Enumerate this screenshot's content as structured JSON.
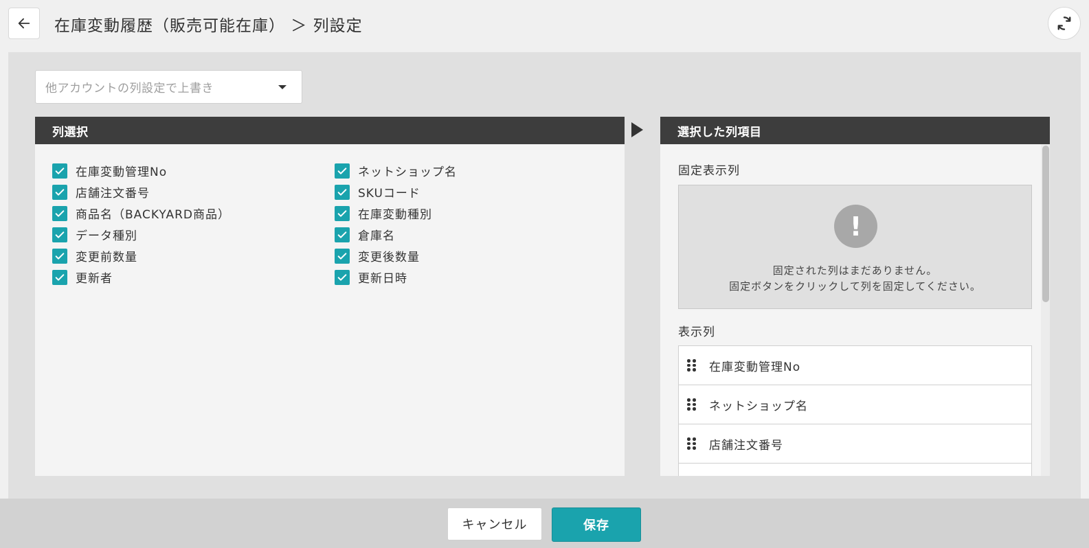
{
  "header": {
    "title": "在庫変動履歴（販売可能在庫） ＞ 列設定"
  },
  "overwrite": {
    "placeholder": "他アカウントの列設定で上書き"
  },
  "column_select": {
    "title": "列選択",
    "left_items": [
      {
        "label": "在庫変動管理No",
        "checked": true
      },
      {
        "label": "店舗注文番号",
        "checked": true
      },
      {
        "label": "商品名（BACKYARD商品）",
        "checked": true
      },
      {
        "label": "データ種別",
        "checked": true
      },
      {
        "label": "変更前数量",
        "checked": true
      },
      {
        "label": "更新者",
        "checked": true
      }
    ],
    "right_items": [
      {
        "label": "ネットショップ名",
        "checked": true
      },
      {
        "label": "SKUコード",
        "checked": true
      },
      {
        "label": "在庫変動種別",
        "checked": true
      },
      {
        "label": "倉庫名",
        "checked": true
      },
      {
        "label": "変更後数量",
        "checked": true
      },
      {
        "label": "更新日時",
        "checked": true
      }
    ]
  },
  "selected_columns": {
    "title": "選択した列項目",
    "fixed_label": "固定表示列",
    "empty_line1": "固定された列はまだありません。",
    "empty_line2": "固定ボタンをクリックして列を固定してください。",
    "display_label": "表示列",
    "display_items": [
      "在庫変動管理No",
      "ネットショップ名",
      "店舗注文番号"
    ]
  },
  "footer": {
    "cancel_label": "キャンセル",
    "save_label": "保存"
  },
  "colors": {
    "accent": "#1aa3ad",
    "panel_header": "#3d3d3d"
  }
}
